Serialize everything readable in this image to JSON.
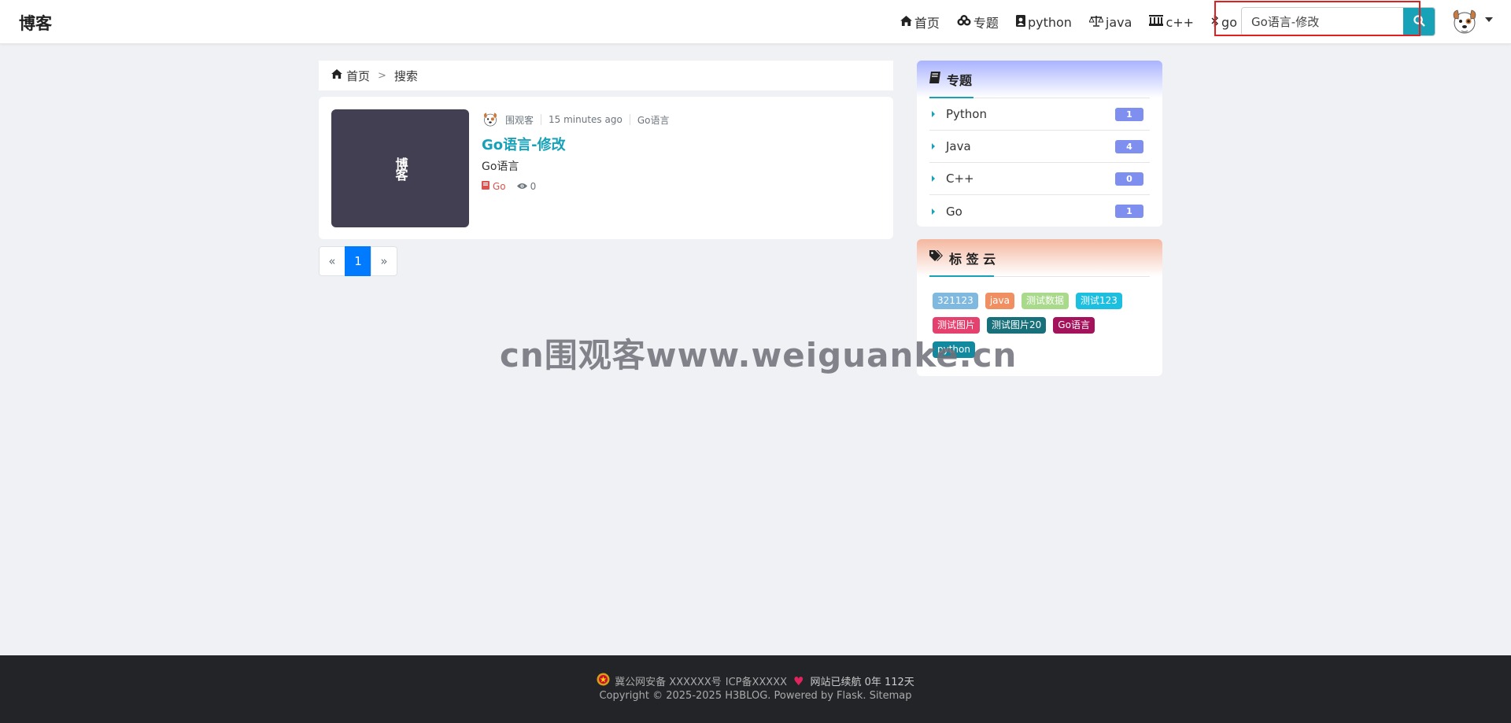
{
  "brand": "博客",
  "nav": {
    "items": [
      {
        "label": "首页",
        "icon": "home-icon"
      },
      {
        "label": "专题",
        "icon": "cubes-icon"
      },
      {
        "label": "python",
        "icon": "file-user-icon"
      },
      {
        "label": "java",
        "icon": "scale-icon"
      },
      {
        "label": "c++",
        "icon": "chess-rook-icon"
      },
      {
        "label": "go",
        "icon": "bluetooth-icon"
      }
    ],
    "search_value": "Go语言-修改"
  },
  "breadcrumb": {
    "home": "首页",
    "separator": ">",
    "current": "搜索"
  },
  "post": {
    "thumb_text": "博客",
    "author": "围观客",
    "time": "15 minutes ago",
    "tag": "Go语言",
    "title": "Go语言-修改",
    "summary": "Go语言",
    "category": "Go",
    "views": "0"
  },
  "pagination": {
    "prev": "«",
    "current": "1",
    "next": "»"
  },
  "topics": {
    "title": "专题",
    "items": [
      {
        "name": "Python",
        "count": "1"
      },
      {
        "name": "Java",
        "count": "4"
      },
      {
        "name": "C++",
        "count": "0"
      },
      {
        "name": "Go",
        "count": "1"
      }
    ]
  },
  "tags": {
    "title": "标 签 云",
    "items": [
      {
        "label": "321123",
        "color": "#7fb9e0"
      },
      {
        "label": "java",
        "color": "#f08f62"
      },
      {
        "label": "测试数据",
        "color": "#a9d98a"
      },
      {
        "label": "测试123",
        "color": "#1cbfe0"
      },
      {
        "label": "测试图片",
        "color": "#e4416f"
      },
      {
        "label": "测试图片20",
        "color": "#18707a"
      },
      {
        "label": "Go语言",
        "color": "#a3125a"
      },
      {
        "label": "python",
        "color": "#118aa0"
      }
    ]
  },
  "watermark": "cn围观客www.weiguanke.cn",
  "footer": {
    "police": "冀公网安备 XXXXXX号",
    "icp": "ICP备XXXXX",
    "runtime": "网站已续航 0年 112天",
    "copyright_prefix": "Copyright © 2025-2025 H3BLOG. Powered by",
    "flask": "Flask.",
    "sitemap": "Sitemap"
  },
  "colors": {
    "accent": "#17a2b8",
    "page_active": "#007bff",
    "badge": "#7f8fef",
    "footer_bg": "#222428"
  }
}
